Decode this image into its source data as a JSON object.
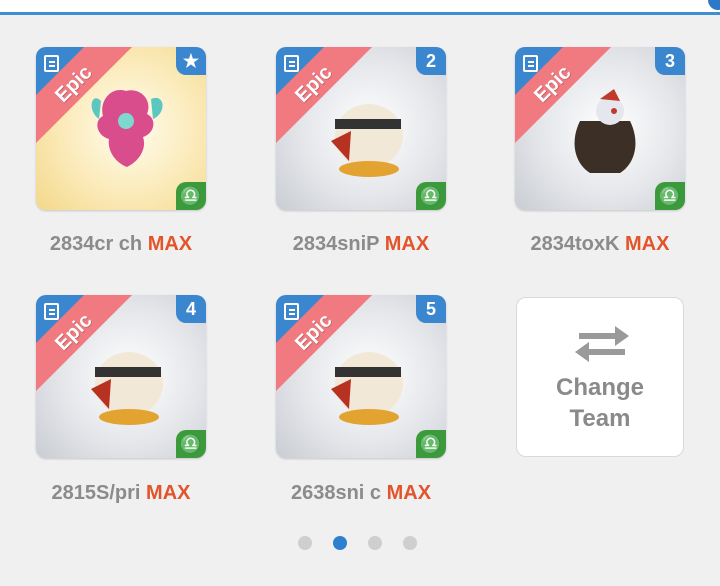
{
  "cards": [
    {
      "rarity": "Epic",
      "badge": "★",
      "name": "2834cr ch",
      "level": "MAX"
    },
    {
      "rarity": "Epic",
      "badge": "2",
      "name": "2834sniP",
      "level": "MAX"
    },
    {
      "rarity": "Epic",
      "badge": "3",
      "name": "2834toxK",
      "level": "MAX"
    },
    {
      "rarity": "Epic",
      "badge": "4",
      "name": "2815S/pri",
      "level": "MAX"
    },
    {
      "rarity": "Epic",
      "badge": "5",
      "name": "2638sni c",
      "level": "MAX"
    }
  ],
  "change_team": {
    "line1": "Change",
    "line2": "Team"
  },
  "pager": {
    "total": 4,
    "active": 2
  },
  "colors": {
    "accent_blue": "#3a87d0",
    "epic_band": "#f07a80",
    "element_green": "#3c9a3d",
    "max_orange": "#e2542a"
  },
  "icons": {
    "book": "book-icon",
    "element": "libra-element-icon",
    "swap": "swap-arrows-icon"
  }
}
